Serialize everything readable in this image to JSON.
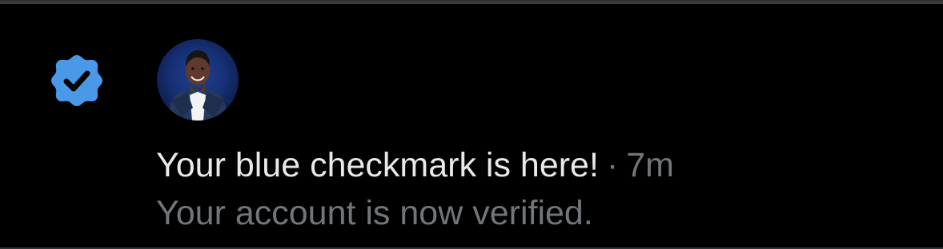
{
  "notification": {
    "icon": "verified-badge-icon",
    "badge_color": "#4a99e9",
    "avatar": "user-avatar",
    "title": "Your blue checkmark is here!",
    "separator": "·",
    "time": "7m",
    "subtitle": "Your account is now verified."
  },
  "colors": {
    "background": "#000000",
    "primary_text": "#e7e9ea",
    "secondary_text": "#71767b"
  }
}
